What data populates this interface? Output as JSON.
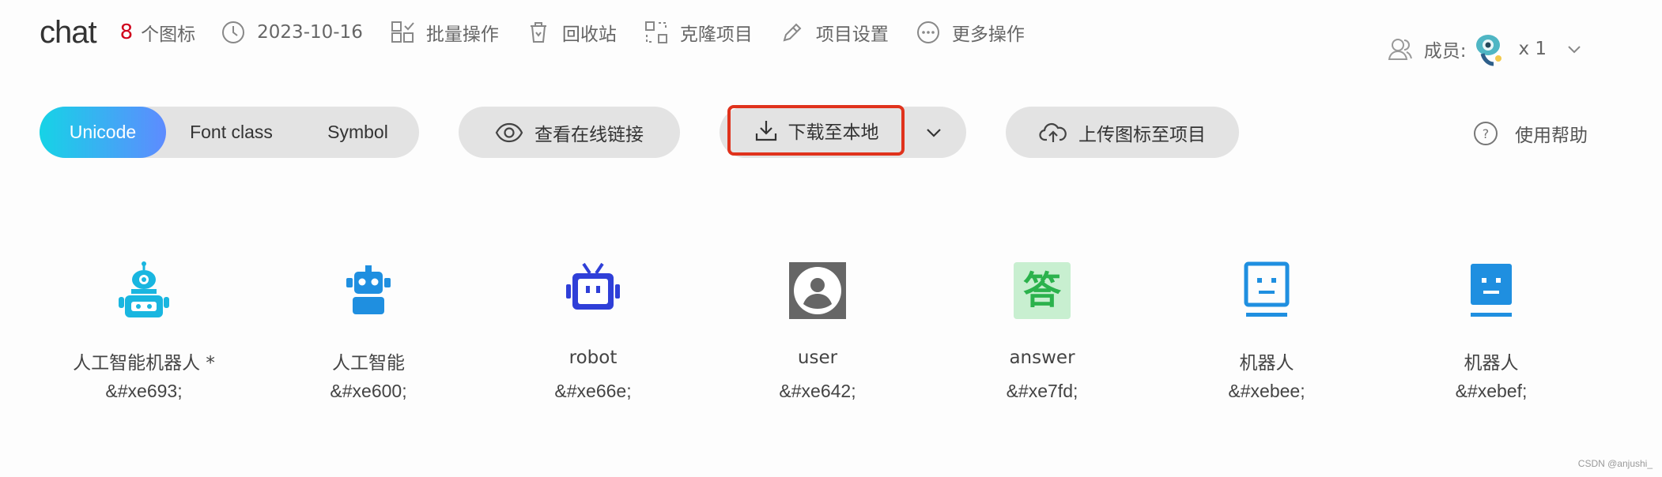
{
  "header": {
    "project_name": "chat",
    "icon_count": "8",
    "icon_count_label": "个图标",
    "date": "2023-10-16",
    "actions": [
      {
        "label": "批量操作",
        "icon": "batch-icon"
      },
      {
        "label": "回收站",
        "icon": "trash-icon"
      },
      {
        "label": "克隆项目",
        "icon": "clone-icon"
      },
      {
        "label": "项目设置",
        "icon": "edit-icon"
      },
      {
        "label": "更多操作",
        "icon": "more-icon"
      }
    ],
    "members_label": "成员:",
    "members_count": "x 1"
  },
  "toolbar": {
    "modes": [
      "Unicode",
      "Font class",
      "Symbol"
    ],
    "active_mode": "Unicode",
    "view_link_label": "查看在线链接",
    "download_label": "下载至本地",
    "upload_label": "上传图标至项目",
    "help_label": "使用帮助",
    "help_icon_glyph": "?"
  },
  "icons": [
    {
      "name": "人工智能机器人 *",
      "code": "&#xe693;",
      "color": "#19b6e0",
      "glyph": "robot-antenna-icon"
    },
    {
      "name": "人工智能",
      "code": "&#xe600;",
      "color": "#1f8fe0",
      "glyph": "robot-head-icon"
    },
    {
      "name": "robot",
      "code": "&#xe66e;",
      "color": "#2f3fd8",
      "glyph": "robot-tv-icon"
    },
    {
      "name": "user",
      "code": "&#xe642;",
      "color": "#666666",
      "glyph": "user-icon"
    },
    {
      "name": "answer",
      "code": "&#xe7fd;",
      "color": "#2bb24c",
      "glyph": "answer-icon",
      "glyph_text": "答"
    },
    {
      "name": "机器人",
      "code": "&#xebee;",
      "color": "#1f8fe0",
      "glyph": "robot-outline-icon"
    },
    {
      "name": "机器人",
      "code": "&#xebef;",
      "color": "#1f8fe0",
      "glyph": "robot-filled-icon"
    }
  ],
  "watermark": "CSDN @anjushi_"
}
